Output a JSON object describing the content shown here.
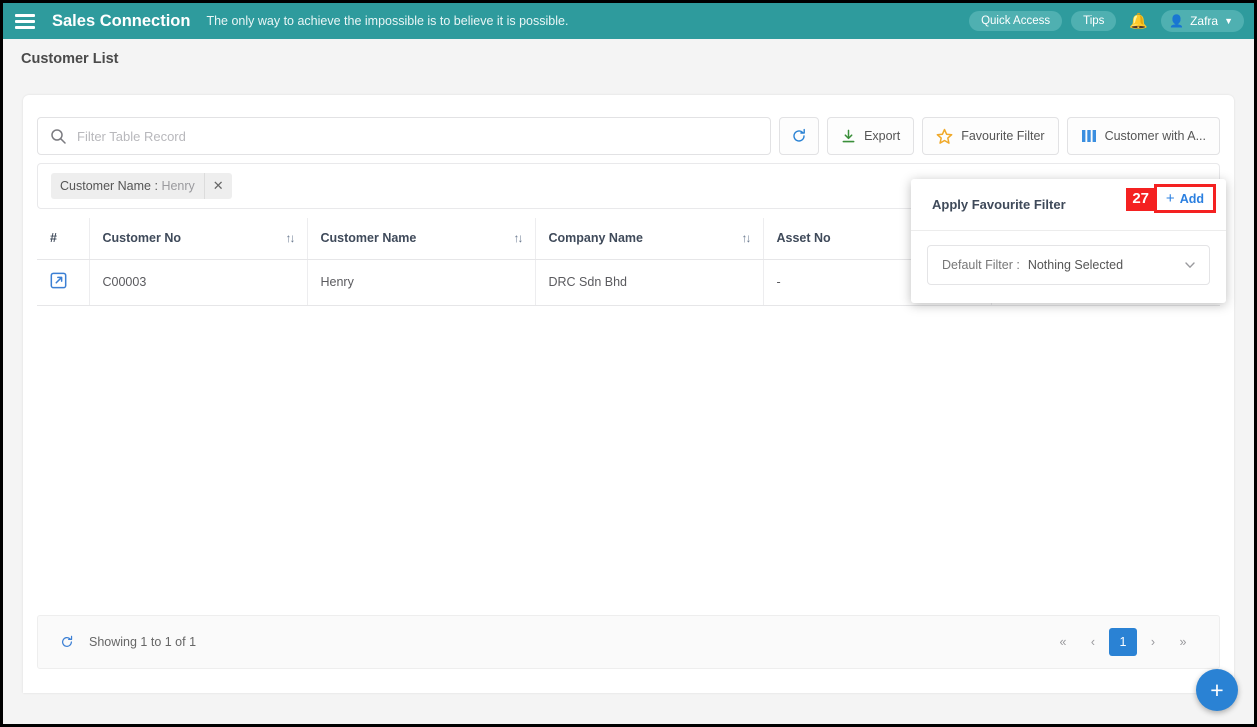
{
  "topbar": {
    "menu_icon": "hamburger-icon",
    "brand": "Sales Connection",
    "tagline": "The only way to achieve the impossible is to believe it is possible.",
    "quick_access": "Quick Access",
    "tips": "Tips",
    "notification_icon": "bell-icon",
    "user_name": "Zafra",
    "accent_color": "#2e9b9d"
  },
  "page": {
    "title": "Customer List"
  },
  "search": {
    "icon": "search-icon",
    "placeholder": "Filter Table Record",
    "value": ""
  },
  "toolbar": {
    "refresh_icon": "refresh-icon",
    "export_label": "Export",
    "export_icon": "download-icon",
    "favourite_filter_label": "Favourite Filter",
    "favourite_filter_icon": "star-icon",
    "columns_label": "Customer with A...",
    "columns_icon": "columns-icon"
  },
  "filter_chip": {
    "field": "Customer Name",
    "separator": ":",
    "value": "Henry",
    "remove_icon": "close-icon"
  },
  "table": {
    "columns": [
      {
        "label": "#",
        "sortable": false
      },
      {
        "label": "Customer No",
        "sortable": true
      },
      {
        "label": "Customer Name",
        "sortable": true
      },
      {
        "label": "Company Name",
        "sortable": true
      },
      {
        "label": "Asset No",
        "sortable": false
      },
      {
        "label": "",
        "sortable": false
      }
    ],
    "sort_icon": "sort-updown-icon",
    "rows": [
      {
        "open_icon": "external-link-icon",
        "customer_no": "C00003",
        "customer_name": "Henry",
        "company_name": "DRC Sdn Bhd",
        "asset_no": "-",
        "extra": "-"
      }
    ]
  },
  "footer": {
    "refresh_icon": "refresh-icon",
    "showing_text": "Showing 1 to 1 of 1",
    "pagination": {
      "first": "«",
      "prev": "‹",
      "pages": [
        "1"
      ],
      "active_page": "1",
      "next": "›",
      "last": "»",
      "active_color": "#2a82d4"
    }
  },
  "favourite_filter_panel": {
    "title": "Apply Favourite Filter",
    "annotation_number": "27",
    "annotation_color": "#f42121",
    "add_label": "Add",
    "add_icon": "plus-icon",
    "default_filter_label": "Default Filter :",
    "default_filter_value": "Nothing Selected",
    "caret_icon": "chevron-down-icon"
  },
  "fab": {
    "icon": "plus-icon",
    "color": "#2a82d4"
  }
}
